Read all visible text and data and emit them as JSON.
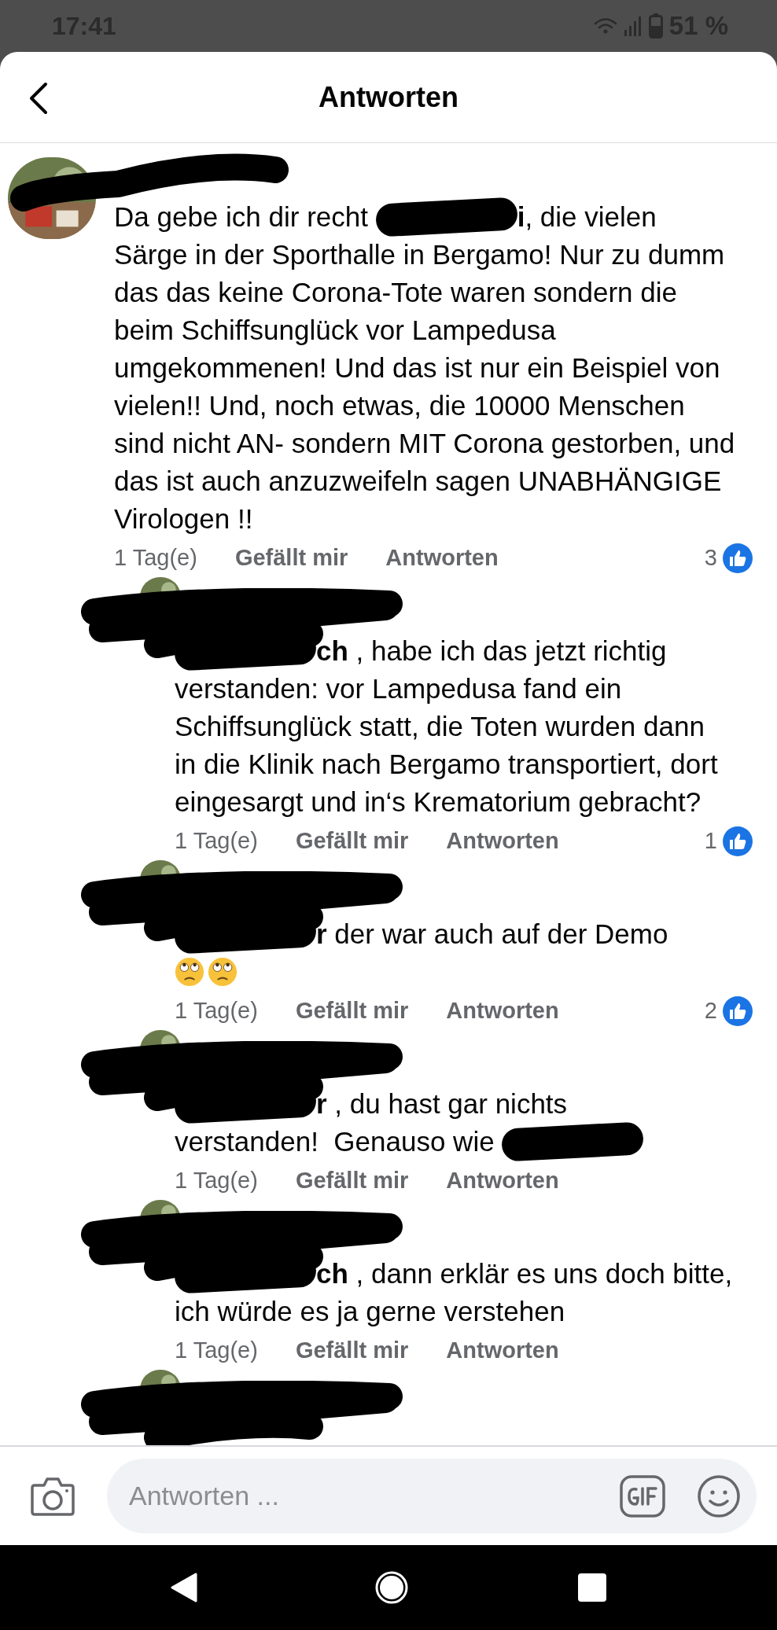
{
  "status_bar": {
    "time": "17:41",
    "battery": "51 %"
  },
  "header": {
    "title": "Antworten"
  },
  "comments": [
    {
      "kind": "comment",
      "author_redacted": true,
      "lines": [
        [
          "Da gebe ich dir recht ",
          {
            "kind": "redaction"
          },
          "**i**, die vielen"
        ],
        [
          "Särge in der Sporthalle in Bergamo! Nur zu dumm"
        ],
        [
          "das das keine Corona-Tote waren sondern die"
        ],
        [
          "beim Schiffsunglück vor Lampedusa"
        ],
        [
          "umgekommenen! Und das ist nur ein Beispiel von"
        ],
        [
          "vielen!! Und, noch etwas, die 10000 Menschen"
        ],
        [
          "sind nicht AN- sondern MIT Corona gestorben, und"
        ],
        [
          "das ist auch anzuzweifeln sagen UNABHÄNGIGE"
        ],
        [
          "Virologen !!"
        ]
      ],
      "time": "1 Tag(e)",
      "actions": [
        "Gefällt mir",
        "Antworten"
      ],
      "likes": "3"
    },
    {
      "kind": "reply",
      "author_redacted": true,
      "lines": [
        [
          {
            "kind": "redaction"
          },
          "**ch** , habe ich das jetzt richtig"
        ],
        [
          "verstanden: vor Lampedusa fand ein"
        ],
        [
          "Schiffsunglück statt, die Toten wurden dann"
        ],
        [
          "in die Klinik nach Bergamo transportiert, dort"
        ],
        [
          "eingesargt und in‘s Krematorium gebracht?"
        ]
      ],
      "time": "1 Tag(e)",
      "actions": [
        "Gefällt mir",
        "Antworten"
      ],
      "likes": "1"
    },
    {
      "kind": "reply",
      "author_redacted": true,
      "lines": [
        [
          {
            "kind": "redaction"
          },
          "**r** der war auch auf der Demo"
        ],
        [
          {
            "kind": "eye-roll"
          },
          {
            "kind": "eye-roll"
          }
        ]
      ],
      "time": "1 Tag(e)",
      "actions": [
        "Gefällt mir",
        "Antworten"
      ],
      "likes": "2"
    },
    {
      "kind": "reply",
      "author_redacted": true,
      "lines": [
        [
          {
            "kind": "redaction"
          },
          "**r** , du hast gar nichts"
        ],
        [
          "verstanden!  Genauso wie ",
          {
            "kind": "redaction"
          }
        ]
      ],
      "time": "1 Tag(e)",
      "actions": [
        "Gefällt mir",
        "Antworten"
      ]
    },
    {
      "kind": "reply",
      "author_redacted": true,
      "lines": [
        [
          {
            "kind": "redaction"
          },
          "**ch** , dann erklär es uns doch bitte,"
        ],
        [
          "ich würde es ja gerne verstehen"
        ]
      ],
      "time": "1 Tag(e)",
      "actions": [
        "Gefällt mir",
        "Antworten"
      ]
    },
    {
      "kind": "reply",
      "author_redacted": true
    }
  ],
  "composer": {
    "placeholder": "Antworten ..."
  }
}
